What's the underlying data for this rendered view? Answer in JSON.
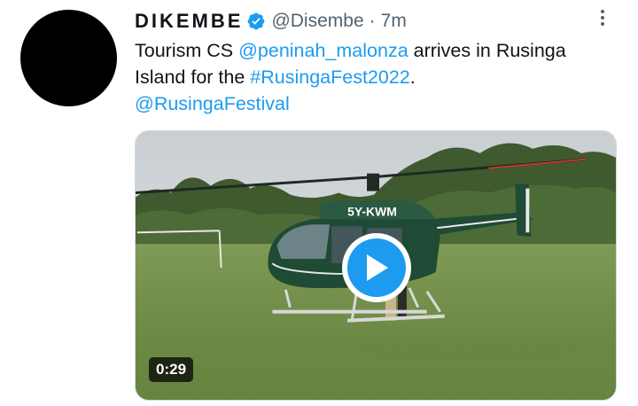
{
  "tweet": {
    "display_name": "DIKEMBE",
    "verified": true,
    "handle": "@Disembe",
    "separator": "·",
    "time": "7m",
    "text": {
      "part1": "Tourism CS ",
      "mention1": "@peninah_malonza",
      "part2": " arrives in Rusinga Island for the ",
      "hashtag": "#RusingaFest2022",
      "part3": ".",
      "mention2": "@RusingaFestival"
    }
  },
  "media": {
    "type": "video",
    "duration": "0:29",
    "registration": "5Y-KWM"
  },
  "icons": {
    "verified": "verified-badge-icon",
    "more": "more-vertical-icon",
    "play": "play-icon"
  },
  "colors": {
    "link": "#1d9bf0",
    "secondary_text": "#536471",
    "avatar": "#000000"
  }
}
